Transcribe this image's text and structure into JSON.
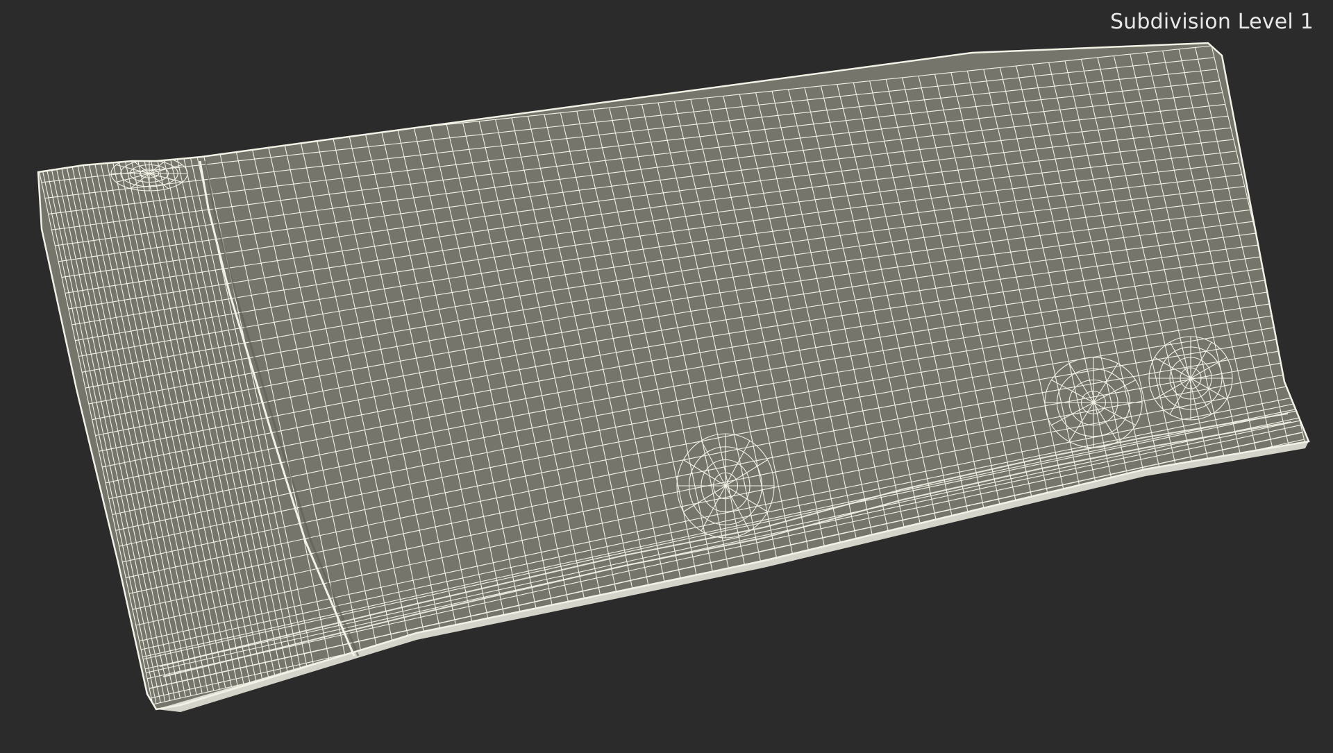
{
  "viewport": {
    "overlay_label": "Subdivision Level 1",
    "background_color": "#2b2b2b",
    "mesh_fill_color": "#75756b",
    "wire_color": "#f2f2e6",
    "object": "flat pouch / sachet wireframe mesh"
  }
}
